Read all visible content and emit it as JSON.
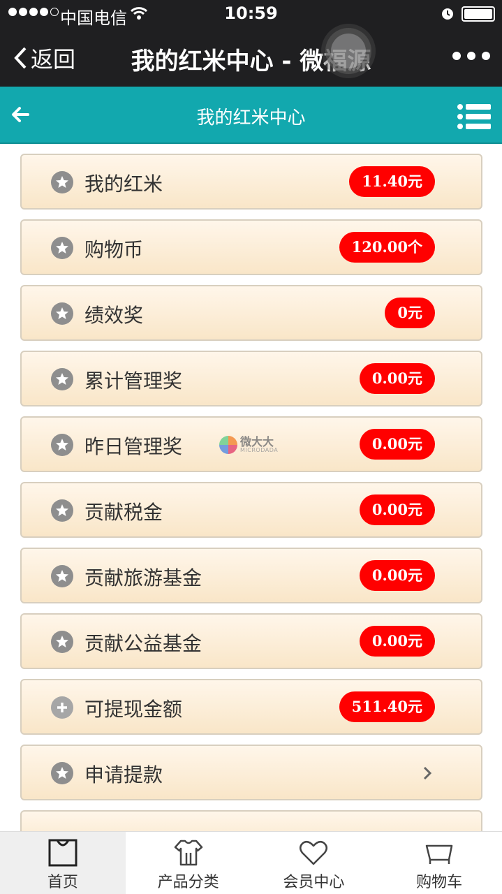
{
  "status_bar": {
    "carrier": "中国电信",
    "time": "10:59"
  },
  "nav_bar": {
    "back_label": "返回",
    "title": "我的红米中心 - 微福源"
  },
  "header": {
    "title": "我的红米中心"
  },
  "items": [
    {
      "label": "我的红米",
      "value": "11.40元",
      "icon": "star-icon"
    },
    {
      "label": "购物币",
      "value": "120.00个",
      "icon": "star-icon"
    },
    {
      "label": "绩效奖",
      "value": "0元",
      "icon": "star-icon"
    },
    {
      "label": "累计管理奖",
      "value": "0.00元",
      "icon": "star-icon"
    },
    {
      "label": "昨日管理奖",
      "value": "0.00元",
      "icon": "star-icon"
    },
    {
      "label": "贡献税金",
      "value": "0.00元",
      "icon": "star-icon"
    },
    {
      "label": "贡献旅游基金",
      "value": "0.00元",
      "icon": "star-icon"
    },
    {
      "label": "贡献公益基金",
      "value": "0.00元",
      "icon": "star-icon"
    },
    {
      "label": "可提现金额",
      "value": "511.40元",
      "icon": "plus-icon"
    },
    {
      "label": "申请提款",
      "icon": "star-icon"
    }
  ],
  "watermark": {
    "main": "微大大",
    "sub": "MICRODADA"
  },
  "tabbar": [
    {
      "label": "首页",
      "icon": "bag-icon"
    },
    {
      "label": "产品分类",
      "icon": "shirt-icon"
    },
    {
      "label": "会员中心",
      "icon": "heart-icon"
    },
    {
      "label": "购物车",
      "icon": "cart-icon"
    }
  ],
  "colors": {
    "header_bg": "#12a8ae",
    "nav_bg": "#1f1f21",
    "badge_bg": "#ff0000",
    "item_bg": "#f9e6c8"
  }
}
